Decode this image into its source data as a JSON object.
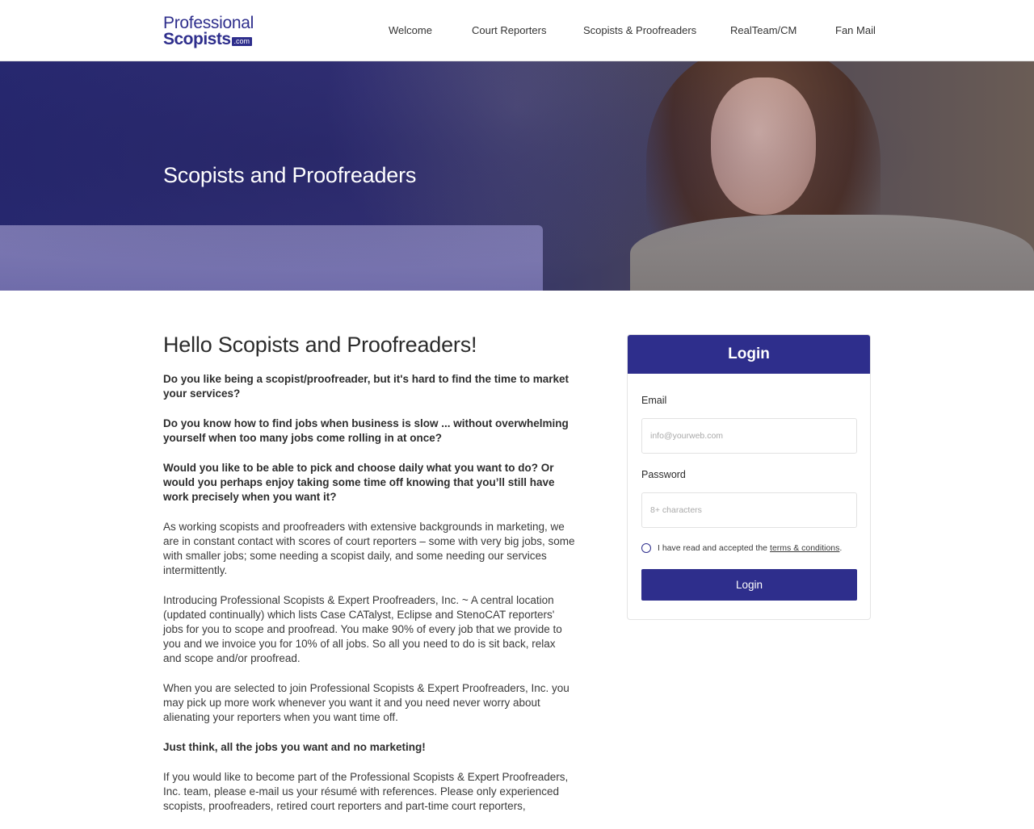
{
  "brand": {
    "line1": "Professional",
    "line2": "Scopists",
    "badge": ".com"
  },
  "nav": {
    "items": [
      {
        "label": "Welcome"
      },
      {
        "label": "Court Reporters"
      },
      {
        "label": "Scopists & Proofreaders"
      },
      {
        "label": "RealTeam/CM"
      },
      {
        "label": "Fan Mail"
      }
    ]
  },
  "hero": {
    "title": "Scopists and Proofreaders"
  },
  "content": {
    "heading": "Hello Scopists and Proofreaders!",
    "paragraphs": [
      "Do you like being a scopist/proofreader, but it's hard to find the time to market your services?",
      "Do you know how to find jobs when business is slow ... without overwhelming yourself when too many jobs come rolling in at once?",
      "Would you like to be able to pick and choose daily what you want to do? Or would you perhaps enjoy taking some time off knowing that you’ll still have work precisely when you want it?",
      "As working scopists and proofreaders with extensive backgrounds in marketing, we are in constant contact with scores of court reporters – some with very big jobs, some with smaller jobs; some needing a scopist daily, and some needing our services intermittently.",
      "Introducing Professional Scopists & Expert Proofreaders, Inc. ~ A central location (updated continually) which lists Case CATalyst, Eclipse and StenoCAT reporters' jobs for you to scope and proofread. You make 90% of every job that we provide to you and we invoice you for 10% of all jobs. So all you need to do is sit back, relax and scope and/or proofread.",
      "When you are selected to join Professional Scopists & Expert Proofreaders, Inc. you may pick up more work whenever you want it and you need never worry about alienating your reporters when you want time off.",
      "Just think, all the jobs you want and no marketing!",
      "If you would like to become part of the Professional Scopists & Expert Proofreaders, Inc. team, please e-mail us your résumé with references. Please only experienced scopists, proofreaders, retired court reporters and part-time court reporters,"
    ]
  },
  "login": {
    "title": "Login",
    "email_label": "Email",
    "email_placeholder": "info@yourweb.com",
    "password_label": "Password",
    "password_placeholder": "8+ characters",
    "terms_text": "I have read and accepted the",
    "terms_link": "terms & conditions",
    "terms_end": ".",
    "button": "Login"
  },
  "colors": {
    "accent": "#2e2e8c"
  },
  "icons": {
    "terms_radio": "radio-unchecked-icon"
  }
}
